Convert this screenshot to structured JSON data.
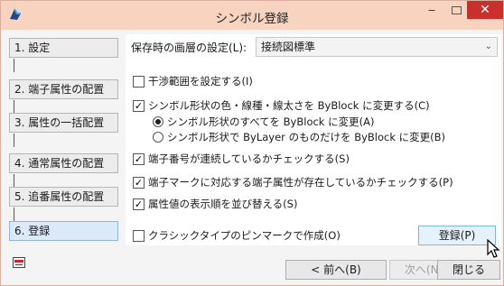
{
  "window": {
    "title": "シンボル登録",
    "minimize_glyph": "‒",
    "close_glyph": "✕"
  },
  "steps": [
    {
      "label": "1. 設定"
    },
    {
      "label": "2. 端子属性の配置"
    },
    {
      "label": "3. 属性の一括配置"
    },
    {
      "label": "4. 通常属性の配置"
    },
    {
      "label": "5. 追番属性の配置"
    },
    {
      "label": "6. 登録"
    }
  ],
  "form": {
    "layer_label": "保存時の画層の設定(L):",
    "layer_value": "接続図標準",
    "interference_label": "干渉範囲を設定する(I)",
    "interference_checked": false,
    "byblock_label": "シンボル形状の色・線種・線太さを ByBlock に変更する(C)",
    "byblock_checked": true,
    "radio_all_label": "シンボル形状のすべてを ByBlock に変更(A)",
    "radio_all_selected": true,
    "radio_bylayer_label": "シンボル形状で ByLayer のものだけを ByBlock に変更(B)",
    "radio_bylayer_selected": false,
    "terminal_seq_label": "端子番号が連続しているかチェックする(S)",
    "terminal_seq_checked": true,
    "terminal_mark_label": "端子マークに対応する端子属性が存在しているかチェックする(P)",
    "terminal_mark_checked": true,
    "attr_sort_label": "属性値の表示順を並び替える(S)",
    "attr_sort_checked": true,
    "classic_pin_label": "クラシックタイプのピンマークで作成(O)",
    "classic_pin_checked": false,
    "check_glyph": "✓"
  },
  "buttons": {
    "register": "登録(P)",
    "back": "< 前へ(B)",
    "next": "次へ(N) >",
    "close": "閉じる"
  },
  "icons": {
    "app": "app-logo-icon",
    "footer": "window-layout-icon",
    "cursor": "mouse-pointer-icon"
  }
}
